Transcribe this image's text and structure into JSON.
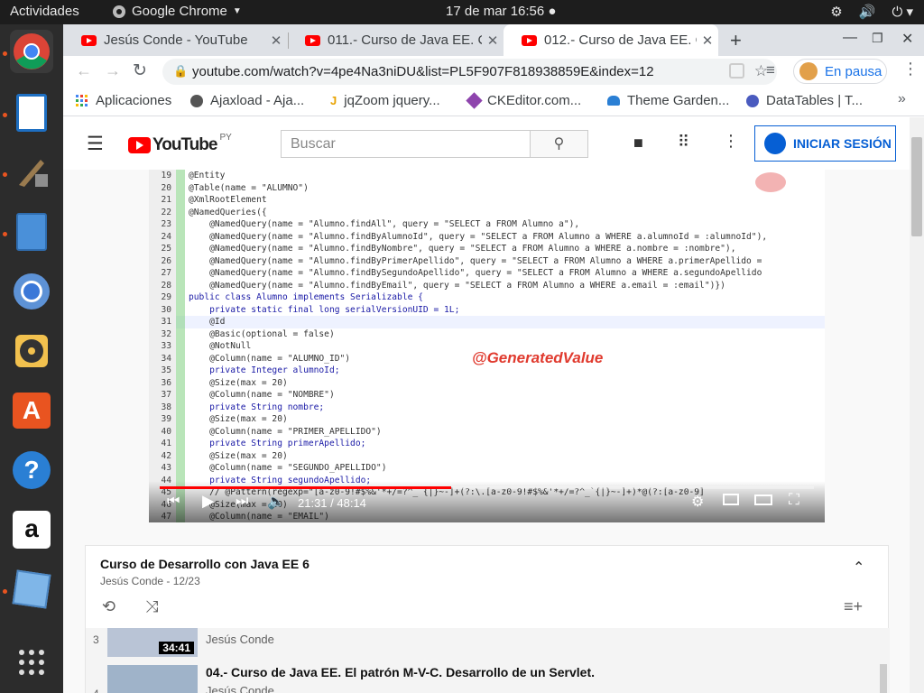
{
  "gnome": {
    "activities": "Actividades",
    "app_name": "Google Chrome",
    "clock": "17 de mar  16:56"
  },
  "tabs": [
    {
      "title": "Jesús Conde - YouTube",
      "active": false
    },
    {
      "title": "011.- Curso de Java EE. Cr",
      "active": false
    },
    {
      "title": "012.- Curso de Java EE. Cr",
      "active": true
    }
  ],
  "toolbar": {
    "url": "youtube.com/watch?v=4pe4Na3niDU&list=PL5F907F818938859E&index=12",
    "paused_label": "En pausa"
  },
  "bookmarks": [
    "Aplicaciones",
    "Ajaxload - Aja...",
    "jqZoom jquery...",
    "CKEditor.com...",
    "Theme Garden...",
    "DataTables | T..."
  ],
  "youtube": {
    "logo": "YouTube",
    "region": "PY",
    "search_placeholder": "Buscar",
    "signin_label": "INICIAR SESIÓN"
  },
  "video": {
    "overlay_text": "@GeneratedValue",
    "time": "21:31 / 48:14",
    "progress": 0.446,
    "code_lines": [
      {
        "n": "19",
        "t": "@Entity"
      },
      {
        "n": "20",
        "t": "@Table(name = \"ALUMNO\")"
      },
      {
        "n": "21",
        "t": "@XmlRootElement"
      },
      {
        "n": "22",
        "t": "@NamedQueries({"
      },
      {
        "n": "23",
        "t": "    @NamedQuery(name = \"Alumno.findAll\", query = \"SELECT a FROM Alumno a\"),"
      },
      {
        "n": "24",
        "t": "    @NamedQuery(name = \"Alumno.findByAlumnoId\", query = \"SELECT a FROM Alumno a WHERE a.alumnoId = :alumnoId\"),"
      },
      {
        "n": "25",
        "t": "    @NamedQuery(name = \"Alumno.findByNombre\", query = \"SELECT a FROM Alumno a WHERE a.nombre = :nombre\"),"
      },
      {
        "n": "26",
        "t": "    @NamedQuery(name = \"Alumno.findByPrimerApellido\", query = \"SELECT a FROM Alumno a WHERE a.primerApellido ="
      },
      {
        "n": "27",
        "t": "    @NamedQuery(name = \"Alumno.findBySegundoApellido\", query = \"SELECT a FROM Alumno a WHERE a.segundoApellido"
      },
      {
        "n": "28",
        "t": "    @NamedQuery(name = \"Alumno.findByEmail\", query = \"SELECT a FROM Alumno a WHERE a.email = :email\")})"
      },
      {
        "n": "29",
        "t": "public class Alumno implements Serializable {"
      },
      {
        "n": "30",
        "t": "    private static final long serialVersionUID = 1L;"
      },
      {
        "n": "31",
        "t": "    @Id"
      },
      {
        "n": "32",
        "t": "    @Basic(optional = false)"
      },
      {
        "n": "33",
        "t": "    @NotNull"
      },
      {
        "n": "34",
        "t": "    @Column(name = \"ALUMNO_ID\")"
      },
      {
        "n": "35",
        "t": "    private Integer alumnoId;"
      },
      {
        "n": "36",
        "t": "    @Size(max = 20)"
      },
      {
        "n": "37",
        "t": "    @Column(name = \"NOMBRE\")"
      },
      {
        "n": "38",
        "t": "    private String nombre;"
      },
      {
        "n": "39",
        "t": "    @Size(max = 20)"
      },
      {
        "n": "40",
        "t": "    @Column(name = \"PRIMER_APELLIDO\")"
      },
      {
        "n": "41",
        "t": "    private String primerApellido;"
      },
      {
        "n": "42",
        "t": "    @Size(max = 20)"
      },
      {
        "n": "43",
        "t": "    @Column(name = \"SEGUNDO_APELLIDO\")"
      },
      {
        "n": "44",
        "t": "    private String segundoApellido;"
      },
      {
        "n": "45",
        "t": "    // @Pattern(regexp=\"[a-z0-9!#$%&'*+/=?^_`{|}~-]+(?:\\.[a-z0-9!#$%&'*+/=?^_`{|}~-]+)*@(?:[a-z0-9]"
      },
      {
        "n": "46",
        "t": "    @Size(max = 20)"
      },
      {
        "n": "47",
        "t": "    @Column(name = \"EMAIL\")"
      }
    ]
  },
  "playlist": {
    "title": "Curso de Desarrollo con Java EE 6",
    "author": "Jesús Conde",
    "position": "12/23",
    "items": [
      {
        "index": "3",
        "duration": "34:41",
        "title": "",
        "author": "Jesús Conde"
      },
      {
        "index": "4",
        "duration": "",
        "title": "04.- Curso de Java EE. El patrón M-V-C. Desarrollo de un Servlet.",
        "author": "Jesús Conde"
      }
    ]
  }
}
